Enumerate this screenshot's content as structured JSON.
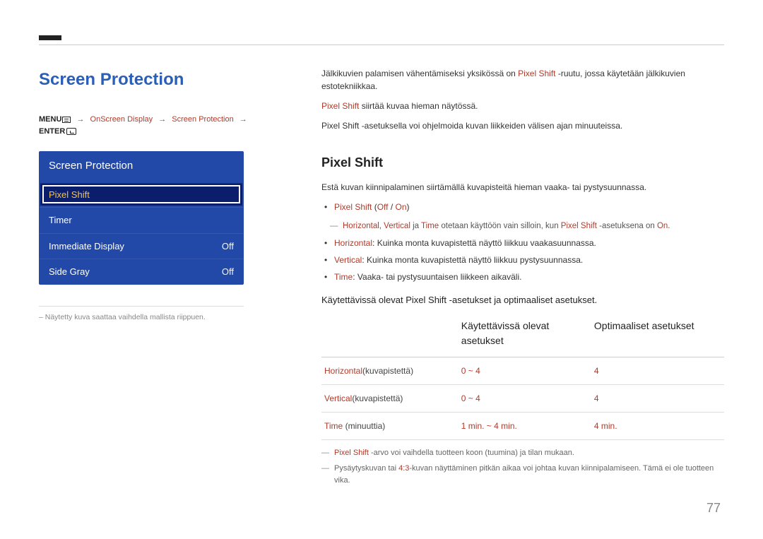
{
  "page_title": "Screen Protection",
  "breadcrumb": {
    "menu_label": "MENU",
    "path1": "OnScreen Display",
    "path2": "Screen Protection",
    "enter_label": "ENTER"
  },
  "menu_panel": {
    "title": "Screen Protection",
    "items": [
      {
        "label": "Pixel Shift",
        "value": "",
        "selected": true
      },
      {
        "label": "Timer",
        "value": ""
      },
      {
        "label": "Immediate Display",
        "value": "Off"
      },
      {
        "label": "Side Gray",
        "value": "Off"
      }
    ]
  },
  "left_note": "– Näytetty kuva saattaa vaihdella mallista riippuen.",
  "intro": {
    "p1_a": "Jälkikuvien palamisen vähentämiseksi yksikössä on ",
    "p1_hl": "Pixel Shift",
    "p1_b": " -ruutu, jossa käytetään jälkikuvien estotekniikkaa.",
    "p2_hl": "Pixel Shift",
    "p2_b": " siirtää kuvaa hieman näytössä.",
    "p3": "Pixel Shift -asetuksella voi ohjelmoida kuvan liikkeiden välisen ajan minuuteissa."
  },
  "section_heading": "Pixel Shift",
  "sect_p": "Estä kuvan kiinnipalaminen siirtämällä kuvapisteitä hieman vaaka- tai pystysuunnassa.",
  "bullet_ps": {
    "label": "Pixel Shift",
    "paren": " (",
    "off": "Off",
    "sep": " / ",
    "on": "On",
    "close": ")"
  },
  "dash1": {
    "a": "Horizontal",
    "b": "Vertical",
    "c": "Time",
    "mid": " otetaan käyttöön vain silloin, kun ",
    "d": "Pixel Shift",
    "e": " -asetuksena on ",
    "f": "On",
    "g": "."
  },
  "bullets2": [
    {
      "hl": "Horizontal",
      "txt": ": Kuinka monta kuvapistettä näyttö liikkuu vaakasuunnassa."
    },
    {
      "hl": "Vertical",
      "txt": ": Kuinka monta kuvapistettä näyttö liikkuu pystysuunnassa."
    },
    {
      "hl": "Time",
      "txt": ": Vaaka- tai pystysuuntaisen liikkeen aikaväli."
    }
  ],
  "sub_heading": "Käytettävissä olevat Pixel Shift -asetukset ja optimaaliset asetukset.",
  "table": {
    "th_empty": "",
    "th_avail": "Käytettävissä olevat asetukset",
    "th_opt": "Optimaaliset asetukset",
    "rows": [
      {
        "name_hl": "Horizontal",
        "name_gray": "(kuvapistettä)",
        "avail": "0 ~ 4",
        "opt": "4"
      },
      {
        "name_hl": "Vertical",
        "name_gray": "(kuvapistettä)",
        "avail": "0 ~ 4",
        "opt": "4"
      },
      {
        "name_hl": "Time",
        "name_gray": " (minuuttia)",
        "avail": "1 min. ~ 4 min.",
        "opt": "4 min."
      }
    ]
  },
  "footnotes": {
    "f1_hl": "Pixel Shift",
    "f1_txt": " -arvo voi vaihdella tuotteen koon (tuumina) ja tilan mukaan.",
    "f2_a": "Pysäytyskuvan tai ",
    "f2_hl": "4:3",
    "f2_b": "-kuvan näyttäminen pitkän aikaa voi johtaa kuvan kiinnipalamiseen. Tämä ei ole tuotteen vika."
  },
  "page_number": "77"
}
